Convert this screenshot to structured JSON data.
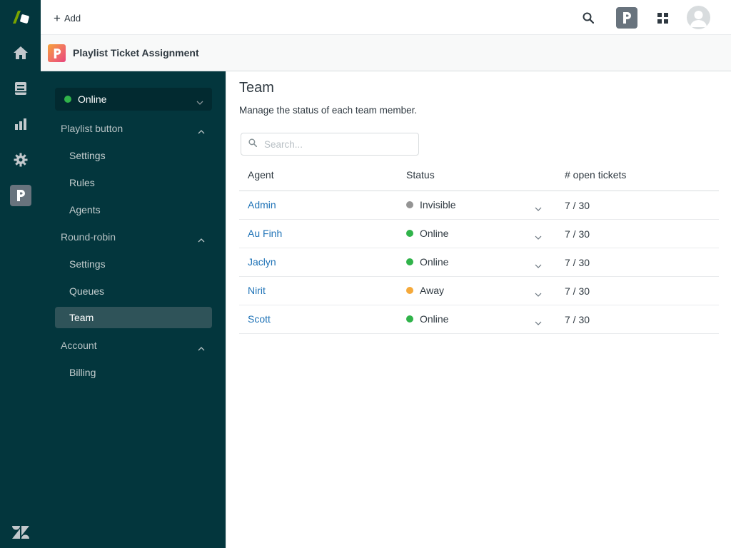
{
  "topbar": {
    "add_label": "Add"
  },
  "app_header": {
    "title": "Playlist Ticket Assignment"
  },
  "sidebar": {
    "status": {
      "label": "Online",
      "color": "#30b34a"
    },
    "items": [
      {
        "label": "Playlist button",
        "type": "section"
      },
      {
        "label": "Settings",
        "type": "sub"
      },
      {
        "label": "Rules",
        "type": "sub"
      },
      {
        "label": "Agents",
        "type": "sub"
      },
      {
        "label": "Round-robin",
        "type": "section"
      },
      {
        "label": "Settings",
        "type": "sub"
      },
      {
        "label": "Queues",
        "type": "sub"
      },
      {
        "label": "Team",
        "type": "sub",
        "active": true
      },
      {
        "label": "Account",
        "type": "section"
      },
      {
        "label": "Billing",
        "type": "sub"
      }
    ]
  },
  "main": {
    "title": "Team",
    "description": "Manage the status of each team member.",
    "search_placeholder": "Search...",
    "columns": [
      "Agent",
      "Status",
      "# open tickets"
    ],
    "rows": [
      {
        "agent": "Admin",
        "status": "Invisible",
        "status_color": "#949494",
        "open": "7 / 30"
      },
      {
        "agent": "Au Finh",
        "status": "Online",
        "status_color": "#30b34a",
        "open": "7 / 30"
      },
      {
        "agent": "Jaclyn",
        "status": "Online",
        "status_color": "#30b34a",
        "open": "7 / 30"
      },
      {
        "agent": "Nirit",
        "status": "Away",
        "status_color": "#f5a93a",
        "open": "7 / 30"
      },
      {
        "agent": "Scott",
        "status": "Online",
        "status_color": "#30b34a",
        "open": "7 / 30"
      }
    ]
  },
  "icons": {
    "rail": [
      "zendesk-product-logo-icon",
      "home-icon",
      "views-icon",
      "reporting-icon",
      "admin-gear-icon",
      "playlist-app-icon",
      "zendesk-logo-icon"
    ],
    "topbar": [
      "plus-icon",
      "search-icon",
      "playlist-app-icon",
      "apps-grid-icon",
      "user-avatar-icon"
    ]
  }
}
